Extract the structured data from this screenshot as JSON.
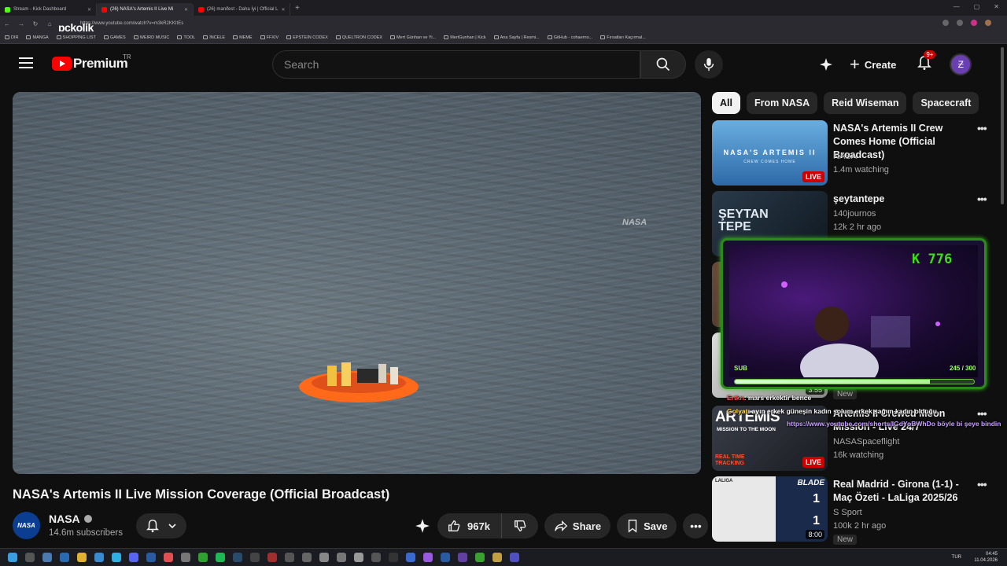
{
  "browser": {
    "tabs": [
      {
        "label": "Stream - Kick Dashboard",
        "color": "#53fc18"
      },
      {
        "label": "(26) NASA's Artemis II Live Mi",
        "color": "#ff0000"
      },
      {
        "label": "(26) manifest - Daha İyi | Official L",
        "color": "#ff0000"
      }
    ],
    "new_tab": "+",
    "url": "https://www.youtube.com/watch?v=m3kR2KKItEs",
    "overlay_logo": "pckolik"
  },
  "bookmarks": [
    "DIR",
    "MANGA",
    "SHOPPING LIST",
    "GAMES",
    "WEIRD MUSIC",
    "TOOL",
    "İNCELE",
    "MEME",
    "FFXIV",
    "EPSTEIN CODEX",
    "QUELTRON CODEX",
    "Mert Günhan ve Yi...",
    "MertGunhan | Kick",
    "Ana Sayfa | Resmi...",
    "GitHub - cohaerno...",
    "Fırsatları Kaçırmal..."
  ],
  "header": {
    "brand": "Premium",
    "region": "TR",
    "search_placeholder": "Search",
    "create_label": "Create",
    "notif_count": "9+"
  },
  "video": {
    "title": "NASA's Artemis II Live Mission Coverage (Official Broadcast)",
    "watermark": "NASA",
    "channel_name": "NASA",
    "channel_avatar_text": "NASA",
    "subscribers": "14.6m subscribers",
    "likes": "967k",
    "share_label": "Share",
    "save_label": "Save",
    "more": "•••"
  },
  "chips": [
    "All",
    "From NASA",
    "Reid Wiseman",
    "Spacecraft"
  ],
  "recommendations": [
    {
      "title": "NASA's Artemis II Crew Comes Home (Official Broadcast)",
      "channel": "NASA",
      "meta": "1.4m watching",
      "badge": "LIVE",
      "thumb_text": "NASA'S ARTEMIS II",
      "thumb_sub": "CREW COMES HOME"
    },
    {
      "title": "şeytantepe",
      "channel": "140journos",
      "meta": "12k  2 hr ago",
      "badge": "",
      "thumb_text": "ŞEYTAN TEPE"
    },
    {
      "title": "Artemis II Crewed Moon Mission - Live 24/7",
      "channel": "NASASpaceflight",
      "meta": "16k watching",
      "badge": "LIVE",
      "thumb_text": "ARTEMIS",
      "thumb_sub": "MISSION TO THE MOON",
      "thumb_sub2": "REAL TIME TRACKING"
    },
    {
      "title": "Real Madrid - Girona (1-1) - Maç Özeti - LaLiga 2025/26",
      "channel": "S Sport",
      "meta": "100k  2 hr ago",
      "badge": "New",
      "thumb_text": "BLADE",
      "score_a": "1",
      "score_b": "1",
      "time": "8:00",
      "league": "LALIGA"
    }
  ],
  "partial": {
    "duration": "3:55",
    "new": "New"
  },
  "stream_overlay": {
    "k_count": "776",
    "sub_label": "SUB",
    "sub_progress": "245 / 300",
    "sub_fraction": 0.8167
  },
  "chat": [
    {
      "user": "Ertkn",
      "message": ": mars erkektir bence"
    },
    {
      "user": "Golyat",
      "message": ": ayın erkek güneşin kadın solum erkek sağım kadın olduğu"
    },
    {
      "user": "",
      "message": "https://www.youtube.com/shorts/IGdYoBWhDo böyle bi şeye bindin"
    }
  ],
  "taskbar": {
    "lang": "TUR",
    "time": "04:45",
    "date": "11.04.2026"
  }
}
